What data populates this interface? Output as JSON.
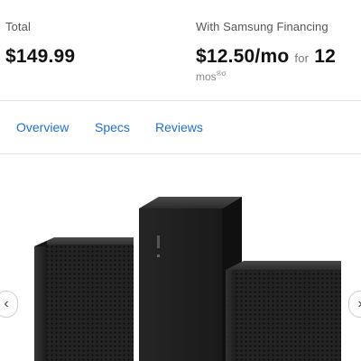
{
  "pricing": {
    "total_label": "Total",
    "total_price": "$149.99",
    "financing_label": "With Samsung Financing",
    "monthly_price": "$12.50/mo",
    "for_text": "for",
    "months": "12",
    "mos_text": "mos",
    "footnote_mark": "®σ"
  },
  "tabs": [
    {
      "label": "Overview"
    },
    {
      "label": "Specs"
    },
    {
      "label": "Reviews"
    }
  ],
  "gallery": {
    "prev_arrow": "‹",
    "next_arrow": "›",
    "product_label_mark": "SAMSUNG"
  },
  "colors": {
    "accent": "#1f6fd1",
    "speaker_body": "#1c1c1c",
    "speaker_grill": "#2a2a2a"
  }
}
